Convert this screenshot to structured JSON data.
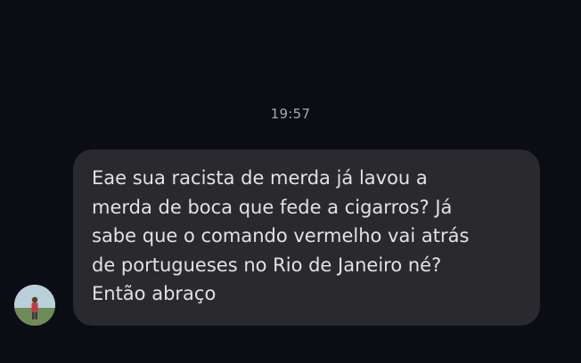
{
  "chat": {
    "timestamp": "19:57",
    "message": {
      "text": "Eae sua racista de merda já lavou a\nmerda de boca que fede a cigarros? Já\nsabe que o comando vermelho vai atrás\nde portugueses no Rio de Janeiro né?\nEntão abraço",
      "sender_avatar": "avatar-icon"
    }
  },
  "colors": {
    "background": "#0b0d14",
    "bubble": "#2a2a2e",
    "text": "#e2e2e4",
    "timestamp": "#a7a9b0"
  }
}
